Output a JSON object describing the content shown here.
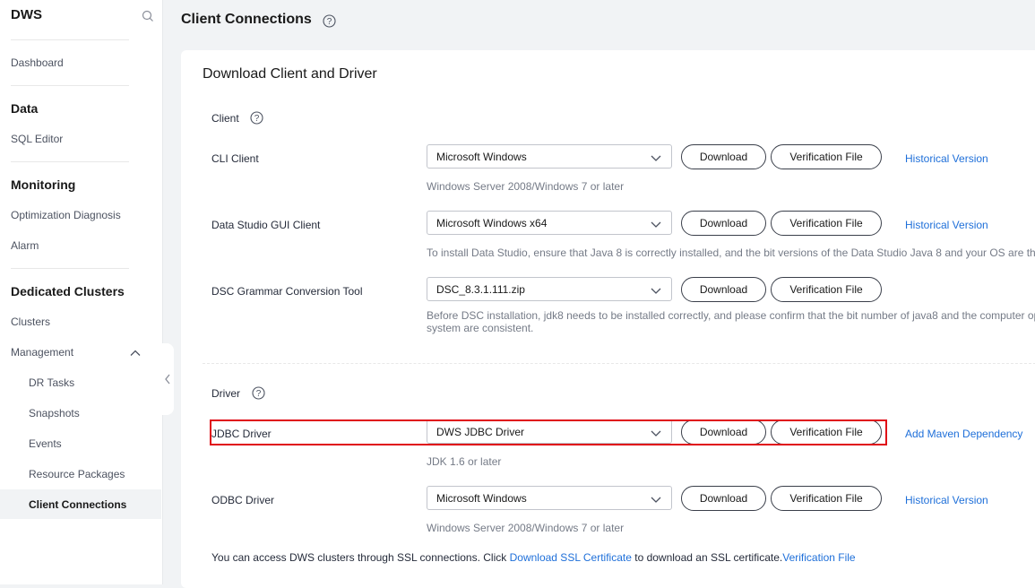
{
  "sidebar": {
    "title": "DWS",
    "dashboard": "Dashboard",
    "group_data": "Data",
    "sql_editor": "SQL Editor",
    "group_monitoring": "Monitoring",
    "optimization": "Optimization Diagnosis",
    "alarm": "Alarm",
    "group_dedicated": "Dedicated Clusters",
    "clusters": "Clusters",
    "management": "Management",
    "dr_tasks": "DR Tasks",
    "snapshots": "Snapshots",
    "events": "Events",
    "resource_packages": "Resource Packages",
    "client_connections": "Client Connections"
  },
  "page": {
    "title": "Client Connections",
    "card_title": "Download Client and Driver"
  },
  "client": {
    "section_label": "Client",
    "cli": {
      "label": "CLI Client",
      "selected": "Microsoft Windows",
      "hint": "Windows Server 2008/Windows 7 or later",
      "link": "Historical Version"
    },
    "studio": {
      "label": "Data Studio GUI Client",
      "selected": "Microsoft Windows x64",
      "hint": "To install Data Studio, ensure that Java 8 is correctly installed, and the bit versions of the Data Studio Java 8 and your OS are th",
      "link": "Historical Version"
    },
    "dsc": {
      "label": "DSC Grammar Conversion Tool",
      "selected": "DSC_8.3.1.111.zip",
      "hint_line1": "Before DSC installation, jdk8 needs to be installed correctly, and please confirm that the bit number of java8 and the computer op",
      "hint_line2": "system are consistent."
    }
  },
  "driver": {
    "section_label": "Driver",
    "jdbc": {
      "label": "JDBC Driver",
      "selected": "DWS JDBC Driver",
      "hint": "JDK 1.6 or later",
      "link": "Add Maven Dependency"
    },
    "odbc": {
      "label": "ODBC Driver",
      "selected": "Microsoft Windows",
      "hint": "Windows Server 2008/Windows 7 or later",
      "link": "Historical Version"
    }
  },
  "buttons": {
    "download": "Download",
    "verification": "Verification File"
  },
  "ssl": {
    "text_before": "You can access DWS clusters through SSL connections. Click ",
    "link_cert": "Download SSL Certificate",
    "text_after": " to download an SSL certificate.",
    "link_verify": "Verification File"
  },
  "colors": {
    "link": "#1e6fd9",
    "highlight_border": "#e00b16",
    "background": "#f1f3f5"
  },
  "icons": [
    "search-icon",
    "help-icon",
    "chevron-down-icon",
    "chevron-up-icon",
    "chevron-left-icon"
  ]
}
